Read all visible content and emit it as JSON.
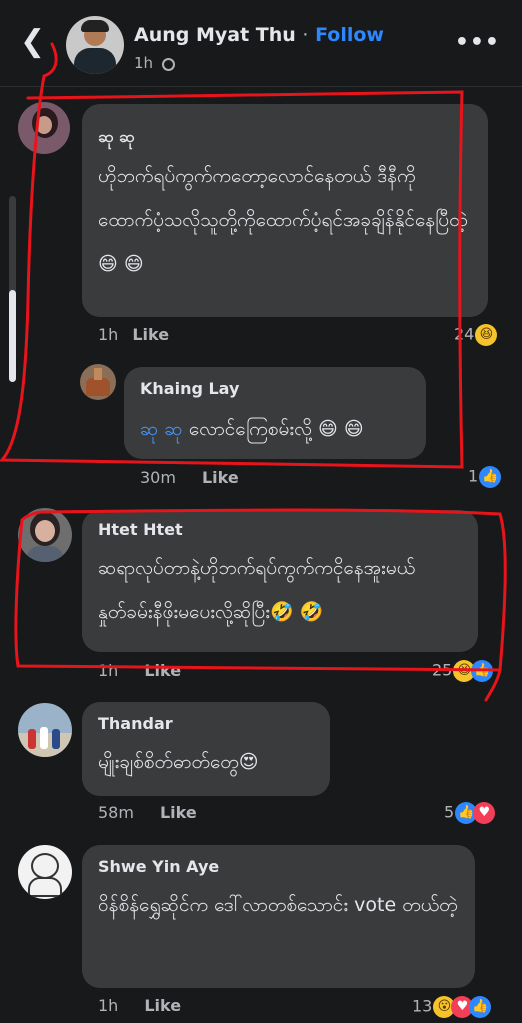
{
  "header": {
    "author": "Aung Myat Thu",
    "separator": "·",
    "follow_label": "Follow",
    "time": "1h",
    "back_icon": "chevron-left-icon",
    "privacy_icon": "globe-icon",
    "more_icon": "more-horizontal-icon"
  },
  "comments": [
    {
      "name": "ဆု ဆု",
      "text": "ဟိုဘက်ရပ်ကွက်ကတော့လောင်နေတယ် ဒီနီကိုထောက်ပံ့သလိုသူတို့ကိုထောက်ပံ့ရင်အခုချိန်နိုင်နေပြီတဲ့😄 😄",
      "time": "1h",
      "like_label": "Like",
      "reaction_count": "24",
      "reactions": [
        "haha"
      ]
    },
    {
      "name": "Khaing Lay",
      "mention": "ဆု ဆု",
      "text": "လောင်ကြေစမ်းလို့ 😄 😄",
      "time": "30m",
      "like_label": "Like",
      "reaction_count": "1",
      "reactions": [
        "like"
      ]
    },
    {
      "name": "Htet Htet",
      "text": "ဆရာလုပ်တာနဲ့ဟိုဘက်ရပ်ကွက်ကငိုနေအူးမယ် နှုတ်ခမ်းနီဖိုးမပေးလို့ဆိုပြီး🤣 🤣",
      "time": "1h",
      "like_label": "Like",
      "reaction_count": "25",
      "reactions": [
        "haha",
        "like"
      ]
    },
    {
      "name": "Thandar",
      "text": "မျိုးချစ်စိတ်ဓာတ်တွေ😍",
      "time": "58m",
      "like_label": "Like",
      "reaction_count": "5",
      "reactions": [
        "like",
        "love"
      ]
    },
    {
      "name": "Shwe Yin Aye",
      "text": "ဝိန်စိန်ရွှေဆိုင်က ဒေါ်လာတစ်သောင်း vote တယ်တဲ့",
      "time": "1h",
      "like_label": "Like",
      "reaction_count": "13",
      "reactions": [
        "wow",
        "love",
        "like"
      ]
    }
  ],
  "colors": {
    "background": "#18191a",
    "bubble": "#3a3b3c",
    "link_blue": "#2d88ff",
    "annotation_red": "#e8141c"
  }
}
